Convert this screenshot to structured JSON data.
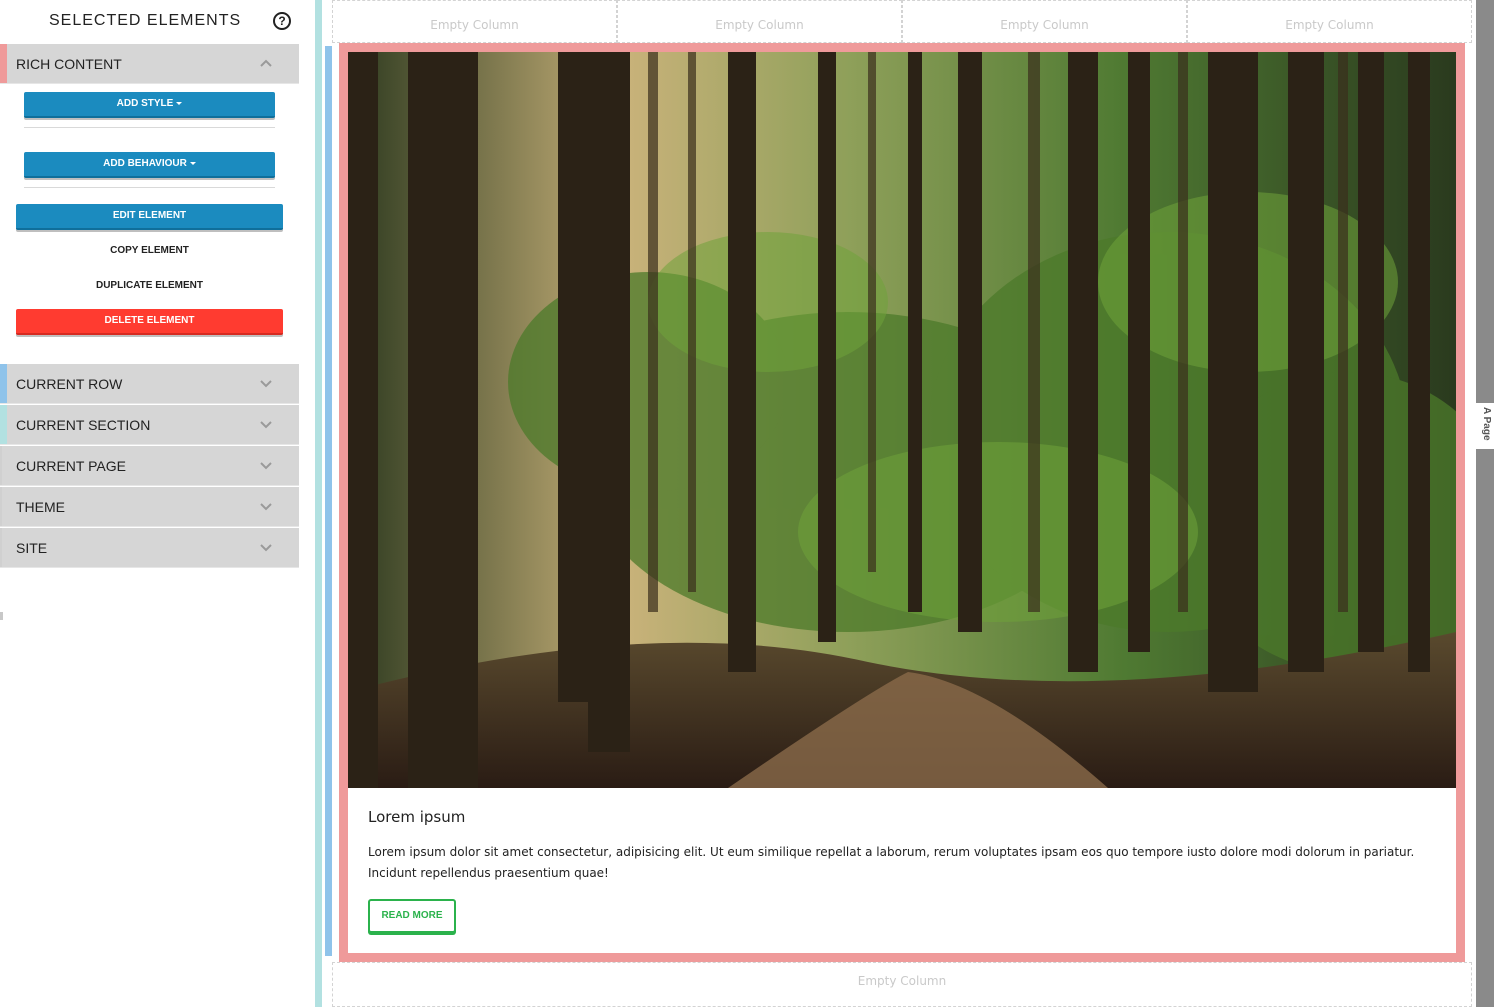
{
  "sidebar": {
    "title": "SELECTED ELEMENTS",
    "help_icon": "?",
    "rich_content": {
      "label": "RICH CONTENT",
      "accent": "#ef9a9a",
      "expanded": true
    },
    "actions": {
      "add_style": "ADD STYLE",
      "add_behaviour": "ADD BEHAVIOUR",
      "edit_element": "EDIT ELEMENT",
      "copy_element": "COPY ELEMENT",
      "duplicate_element": "DUPLICATE ELEMENT",
      "delete_element": "DELETE ELEMENT"
    },
    "sections": [
      {
        "label": "CURRENT ROW",
        "accent": "#8fc3ea"
      },
      {
        "label": "CURRENT SECTION",
        "accent": "#b2e1e1"
      },
      {
        "label": "CURRENT PAGE",
        "accent": ""
      },
      {
        "label": "THEME",
        "accent": ""
      },
      {
        "label": "SITE",
        "accent": ""
      }
    ]
  },
  "canvas": {
    "empty_columns_top": [
      "Empty Column",
      "Empty Column",
      "Empty Column",
      "Empty Column"
    ],
    "empty_column_bottom": "Empty Column",
    "card": {
      "title": "Lorem ipsum",
      "text": "Lorem ipsum dolor sit amet consectetur, adipisicing elit. Ut eum similique repellat a laborum, rerum voluptates ipsam eos quo tempore iusto dolore modi dolorum in pariatur. Incidunt repellendus praesentium quae!",
      "button": "READ MORE"
    },
    "page_tab": "A Page"
  },
  "colors": {
    "primary_button": "#1b8bbf",
    "danger_button": "#ff3b30",
    "selected_element": "#ef9a9a",
    "row": "#8fc3ea",
    "section": "#b2e1e1",
    "read_more": "#2bb24c"
  },
  "icons": {
    "help": "question-circle-icon",
    "expand": "chevron-down-icon",
    "collapse": "chevron-up-icon",
    "dropdown": "caret-down-icon"
  }
}
